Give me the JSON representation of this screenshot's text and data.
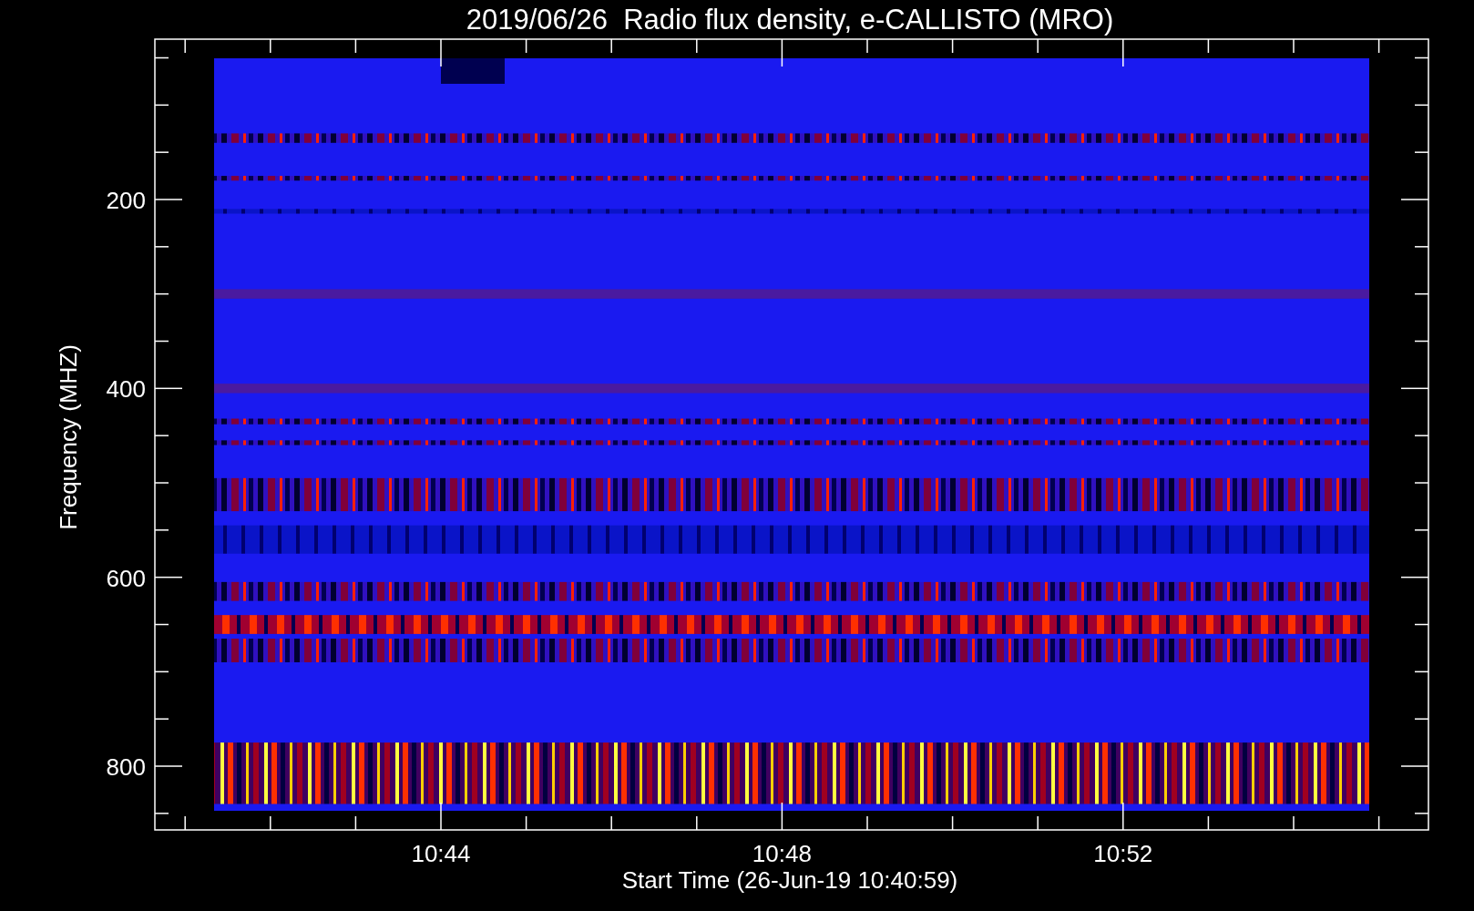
{
  "title": "2019/06/26  Radio flux density, e-CALLISTO (MRO)",
  "y_axis": {
    "label": "Frequency (MHZ)",
    "ticks": [
      "200",
      "400",
      "600",
      "800"
    ]
  },
  "x_axis": {
    "label": "Start Time (26-Jun-19 10:40:59)",
    "ticks": [
      "10:44",
      "10:48",
      "10:52"
    ]
  }
}
